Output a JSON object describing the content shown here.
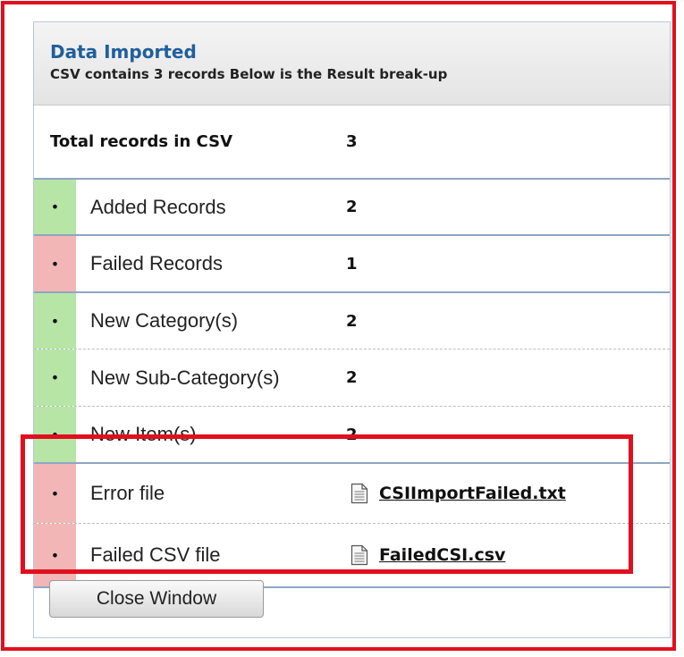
{
  "header": {
    "title": "Data Imported",
    "subtitle": "CSV contains 3 records Below is the Result break-up"
  },
  "total": {
    "label": "Total records in CSV",
    "value": "3"
  },
  "rows": [
    {
      "label": "Added Records",
      "value": "2",
      "status": "ok"
    },
    {
      "label": "Failed Records",
      "value": "1",
      "status": "fail"
    },
    {
      "label": "New Category(s)",
      "value": "2",
      "status": "ok"
    },
    {
      "label": "New Sub-Category(s)",
      "value": "2",
      "status": "ok"
    },
    {
      "label": "New Item(s)",
      "value": "2",
      "status": "ok"
    }
  ],
  "files": [
    {
      "label": "Error file",
      "link": "CSIImportFailed.txt",
      "status": "fail"
    },
    {
      "label": "Failed CSV file",
      "link": "FailedCSI.csv",
      "status": "fail"
    }
  ],
  "bullet": "•",
  "close_button": "Close Window",
  "colors": {
    "ok": "#b6e5a6",
    "fail": "#f3b6b6",
    "title": "#1f5f9c",
    "highlight": "#e0101e"
  },
  "icons": {
    "file": "document-icon"
  }
}
